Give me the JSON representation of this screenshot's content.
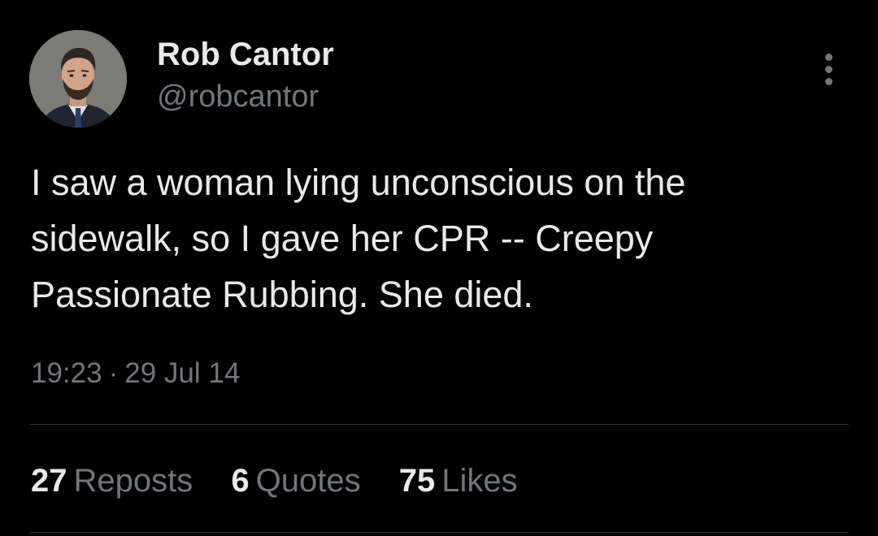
{
  "author": {
    "display_name": "Rob Cantor",
    "handle": "@robcantor",
    "avatar": "profile-photo"
  },
  "tweet": {
    "text_lines": [
      "I saw a woman lying unconscious on the",
      "sidewalk, so I gave her CPR -- Creepy",
      "Passionate Rubbing. She died."
    ],
    "time": "19:23",
    "separator": "·",
    "date": "29 Jul 14"
  },
  "stats": {
    "reposts": {
      "count": "27",
      "label": "Reposts"
    },
    "quotes": {
      "count": "6",
      "label": "Quotes"
    },
    "likes": {
      "count": "75",
      "label": "Likes"
    }
  },
  "menu": {
    "icon": "more-vertical-icon"
  },
  "colors": {
    "background": "#000000",
    "primary_text": "#e7e9ea",
    "secondary_text": "#71767b",
    "divider": "#2f3336"
  }
}
